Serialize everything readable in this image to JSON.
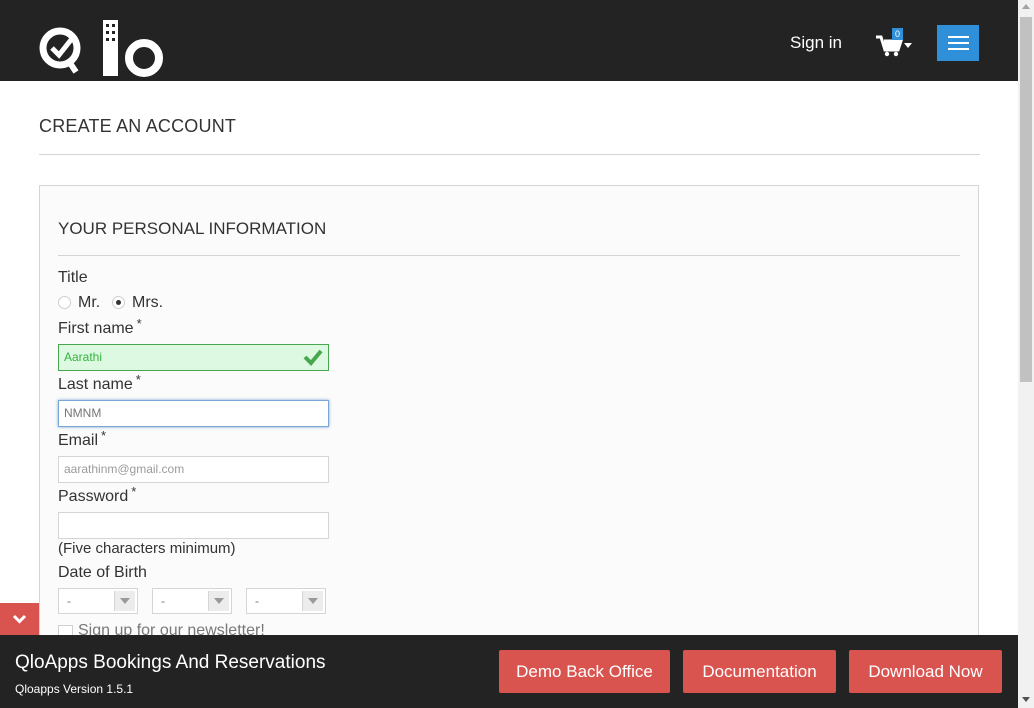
{
  "header": {
    "signin_label": "Sign in",
    "cart_count": "0",
    "brand_color": "#232323",
    "accent_color": "#2f8fd8"
  },
  "page": {
    "title": "CREATE AN ACCOUNT"
  },
  "form": {
    "section_title": "YOUR PERSONAL INFORMATION",
    "title_label": "Title",
    "title_options": [
      "Mr.",
      "Mrs."
    ],
    "title_selected": "Mrs.",
    "first_name_label": "First name",
    "first_name_value": "Aarathi",
    "last_name_label": "Last name",
    "last_name_value": "NMNM",
    "email_label": "Email",
    "email_value": "aarathinm@gmail.com",
    "password_label": "Password",
    "password_value": "",
    "password_hint": "(Five characters minimum)",
    "dob_label": "Date of Birth",
    "dob_day": "-",
    "dob_month": "-",
    "dob_year": "-",
    "newsletter_label": "Sign up for our newsletter!",
    "required_mark": "*"
  },
  "footer": {
    "title": "QloApps Bookings And Reservations",
    "version": "Qloapps Version 1.5.1",
    "buttons": [
      "Demo Back Office",
      "Documentation",
      "Download Now"
    ],
    "button_color": "#d9534f"
  },
  "icons": [
    "logo-icon",
    "cart-icon",
    "caret-down-icon",
    "hamburger-menu-icon",
    "checkmark-icon",
    "chevron-down-icon"
  ]
}
